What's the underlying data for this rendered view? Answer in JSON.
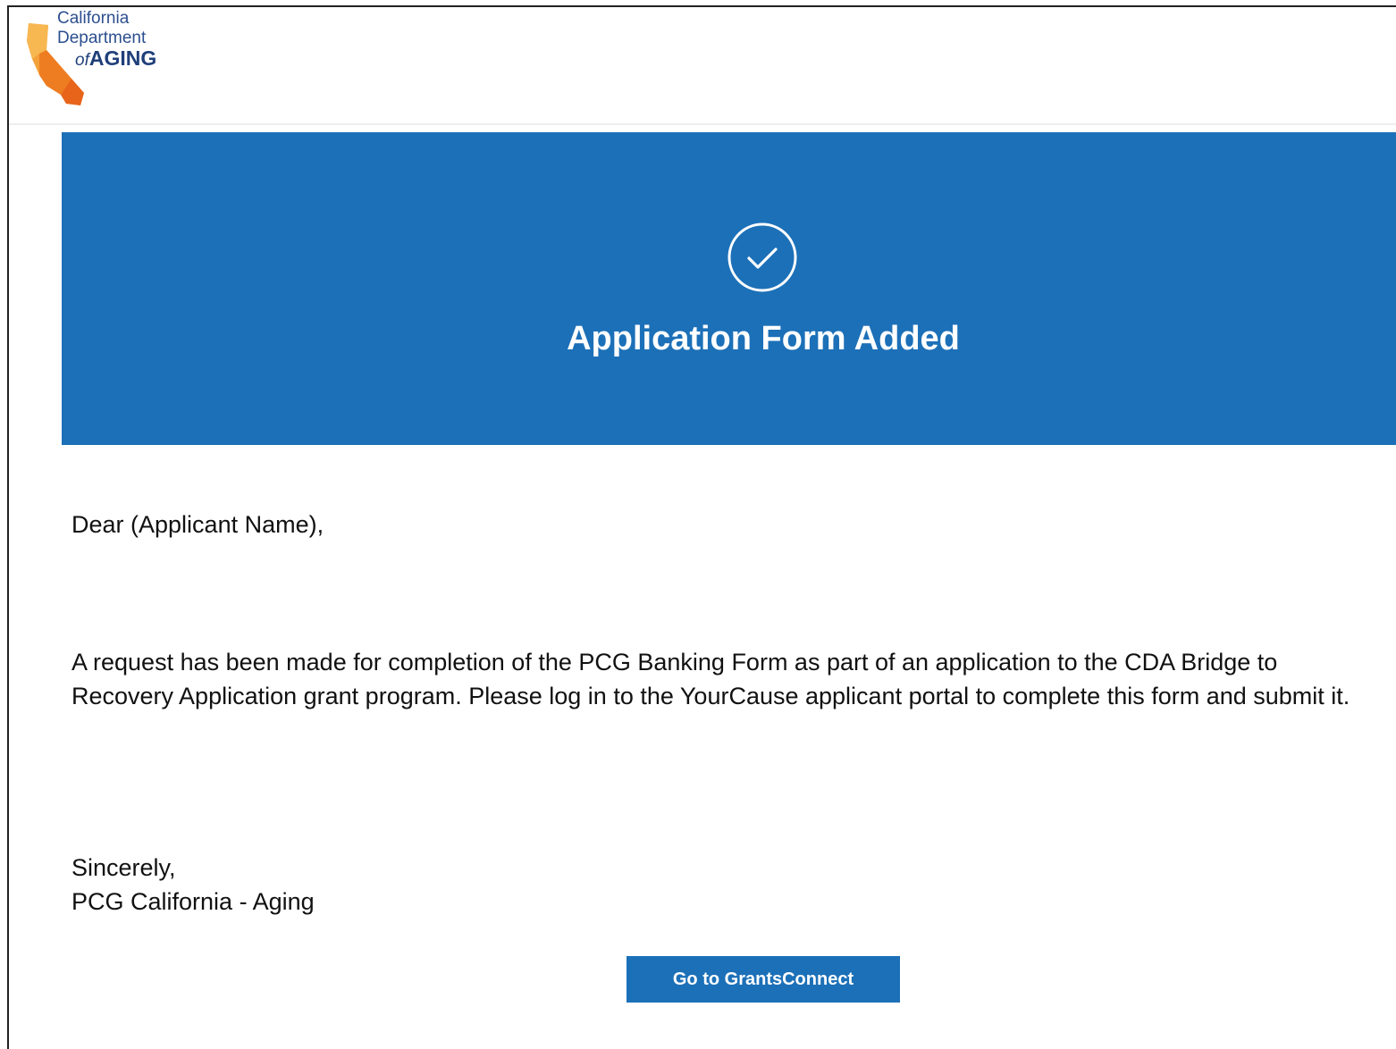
{
  "logo": {
    "line1": "California",
    "line2": "Department",
    "line3_of": "of",
    "line3_aging": "AGING"
  },
  "banner": {
    "icon": "check-circle-icon",
    "title": "Application Form Added",
    "color": "#1c70b8"
  },
  "email": {
    "greeting": "Dear (Applicant Name),",
    "message": "A request has been made for completion of the PCG Banking Form as part of an application to the CDA Bridge to Recovery Application grant program. Please log in to the YourCause applicant portal to complete this form and submit it.",
    "closing": "Sincerely,",
    "signature": "PCG California - Aging"
  },
  "cta": {
    "label": "Go to GrantsConnect"
  },
  "colors": {
    "accent": "#1c70b8",
    "logo_text": "#1f3f7a",
    "logo_orange": "#f08a24"
  }
}
